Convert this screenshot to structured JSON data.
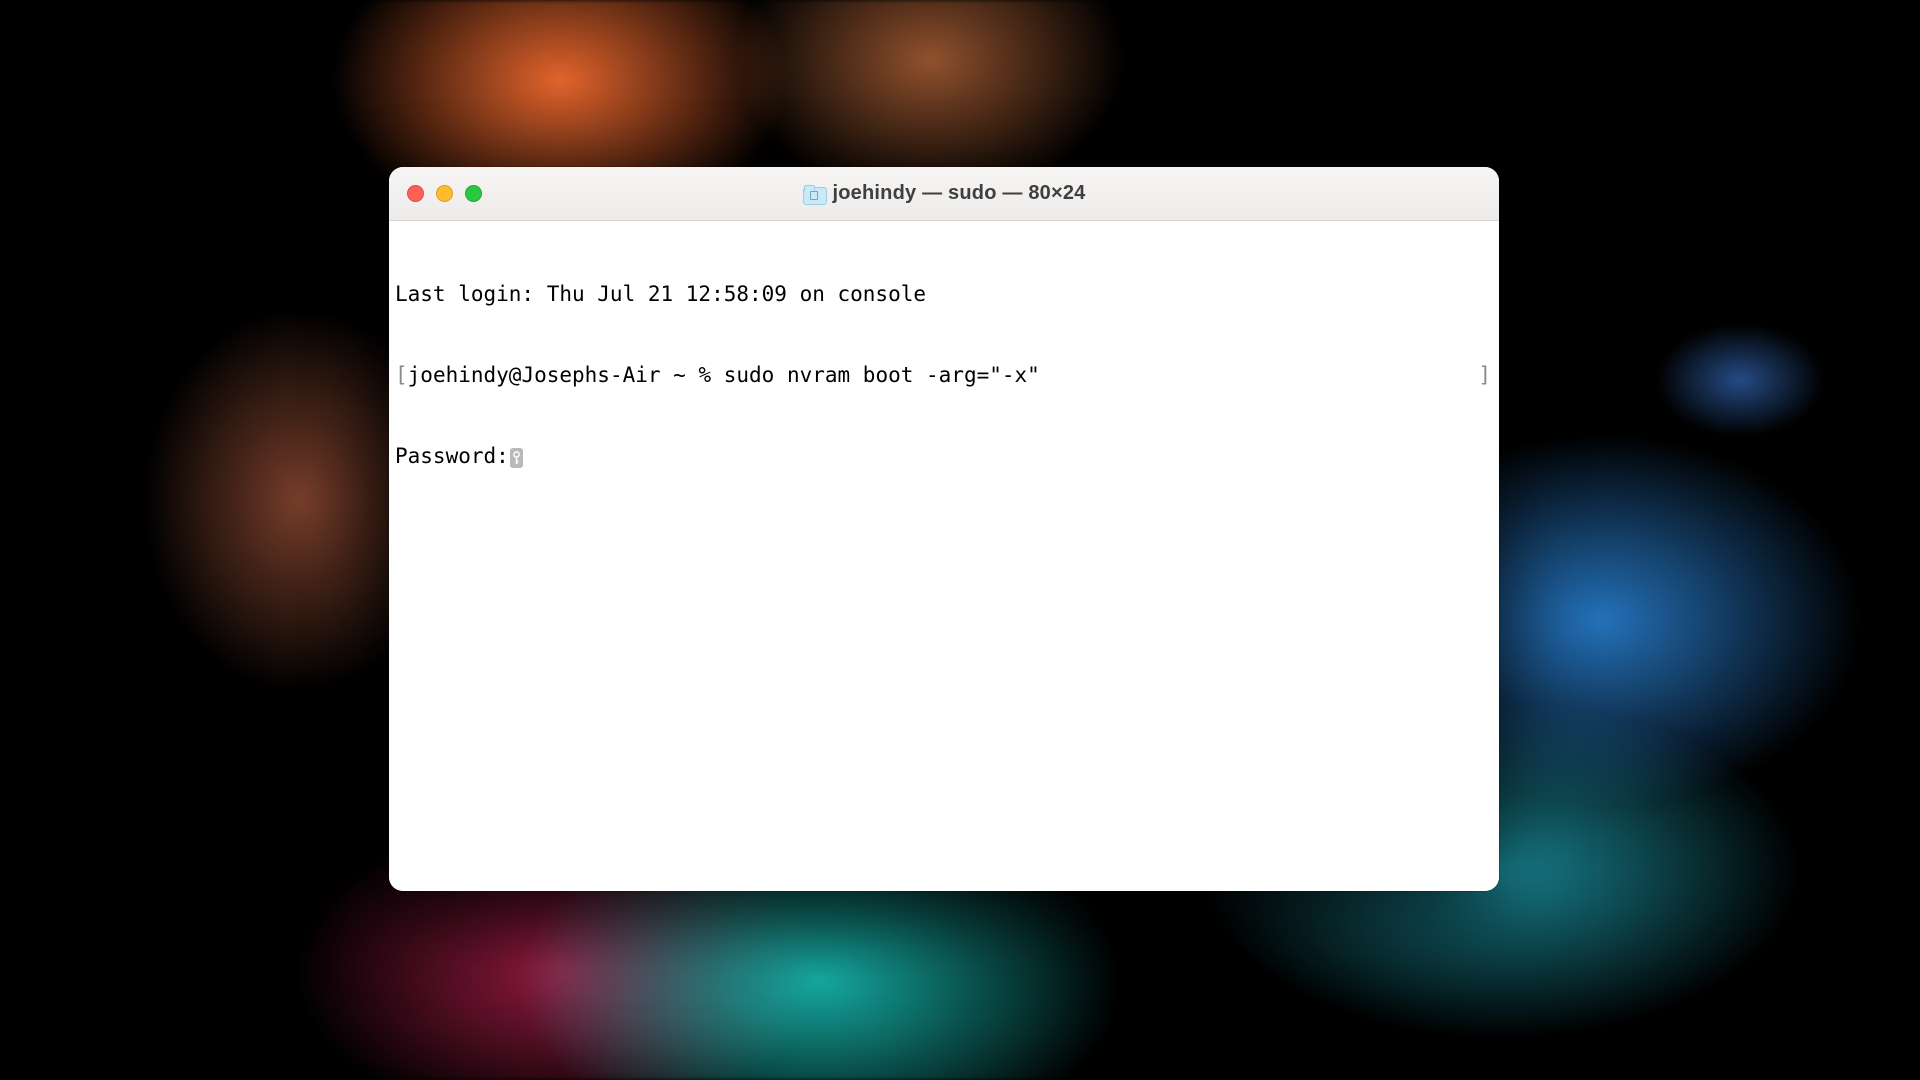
{
  "window": {
    "title": "joehindy — sudo — 80×24"
  },
  "terminal": {
    "last_login_line": "Last login: Thu Jul 21 12:58:09 on console",
    "prompt_open_bracket": "[",
    "prompt": "joehindy@Josephs-Air ~ % ",
    "command": "sudo nvram boot -arg=\"-x\"",
    "prompt_close_bracket": "]",
    "password_label": "Password:"
  }
}
